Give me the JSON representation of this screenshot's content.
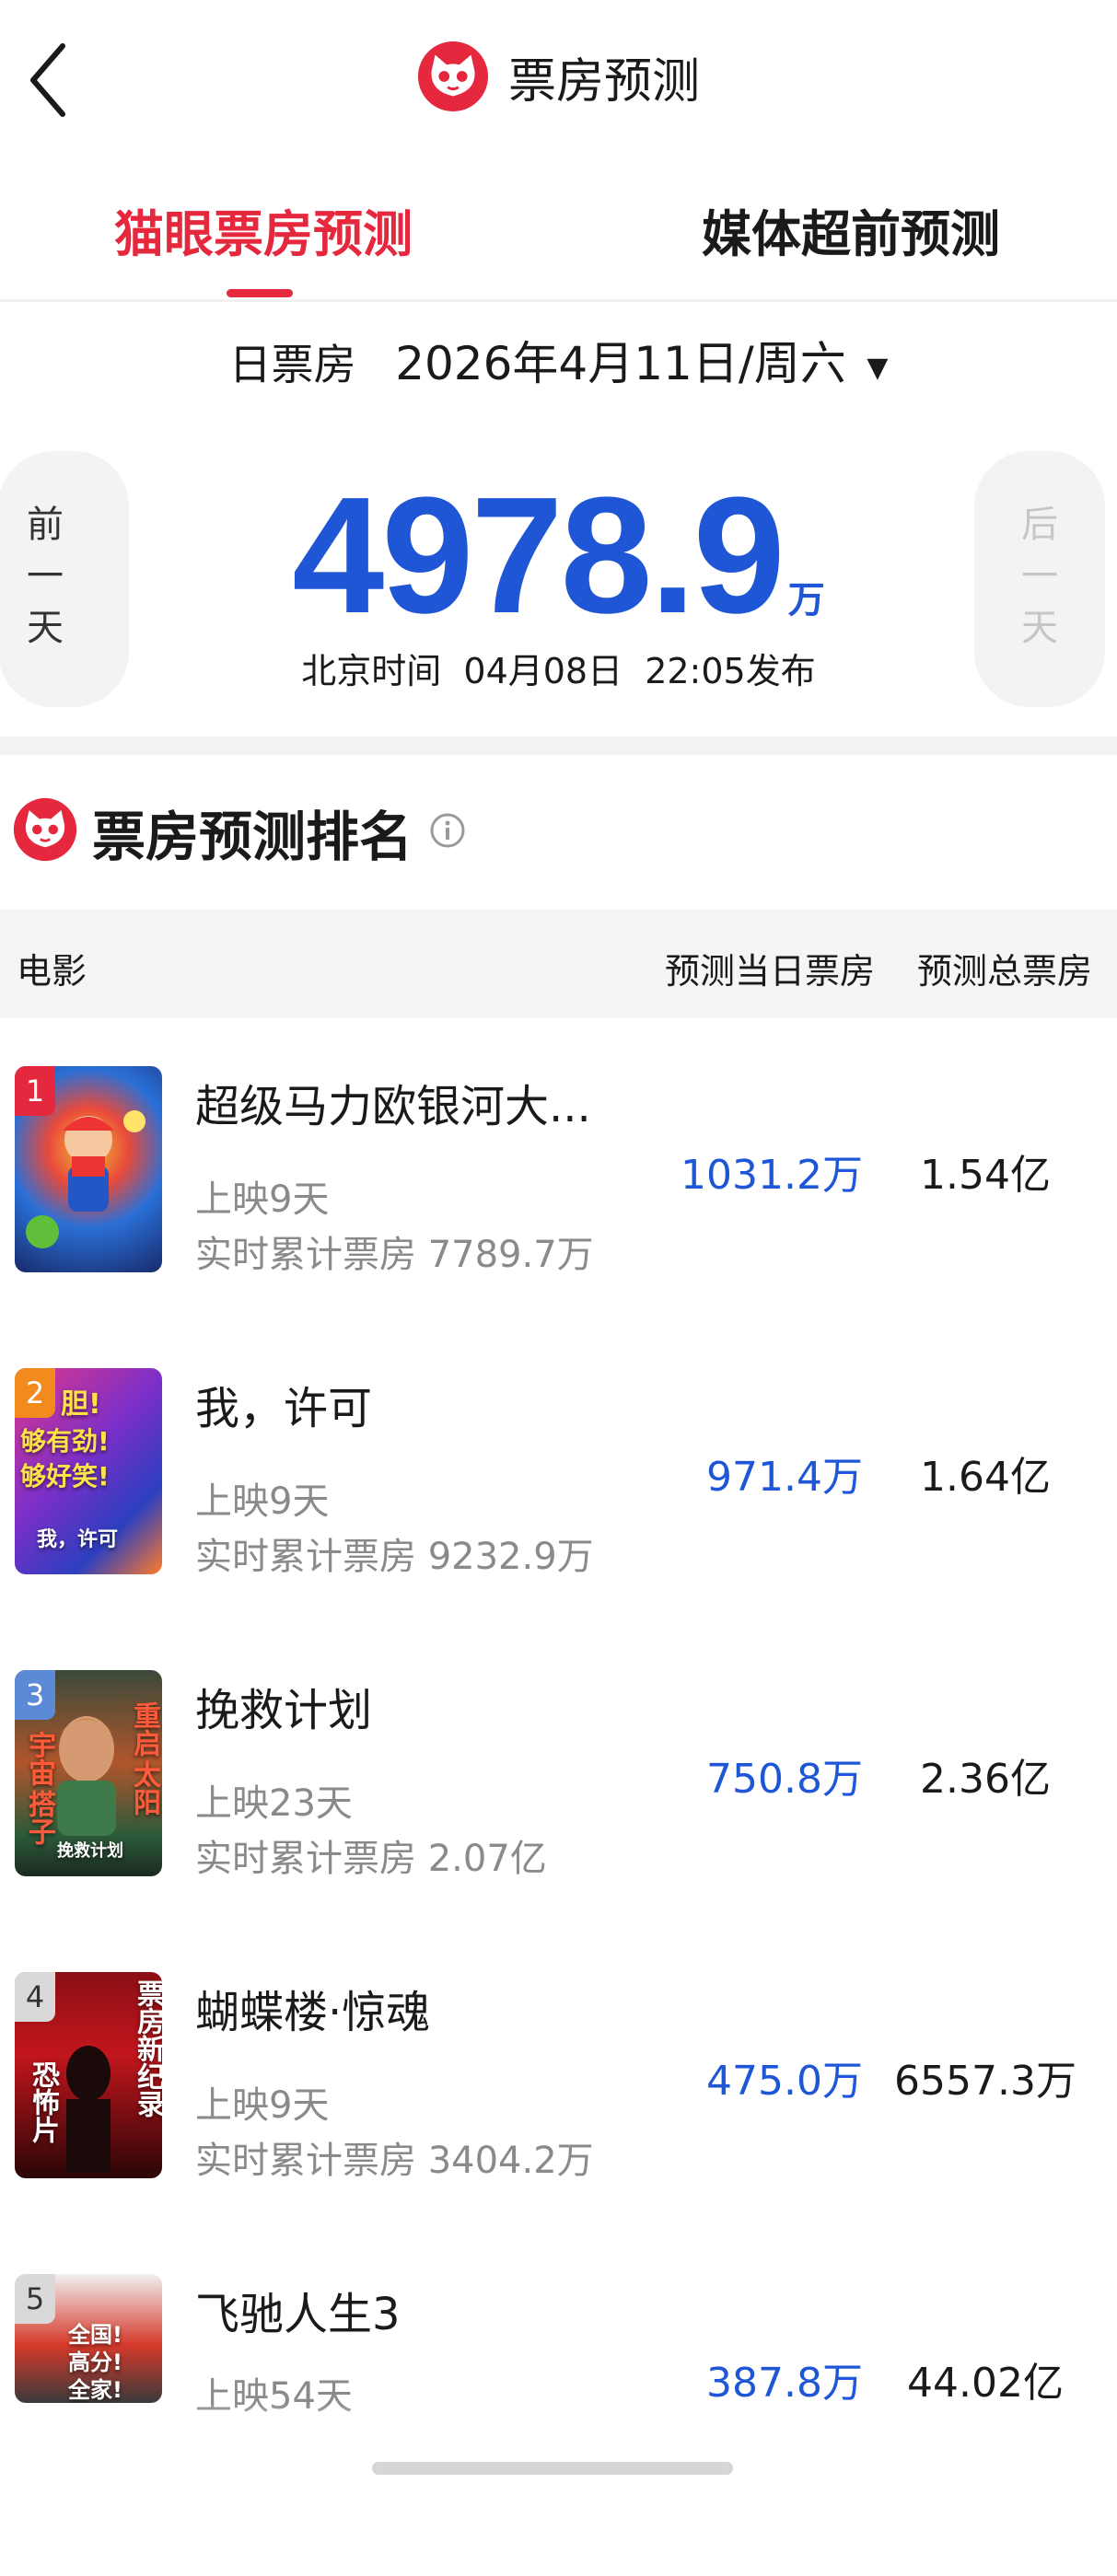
{
  "header": {
    "title": "票房预测"
  },
  "tabs": [
    {
      "label": "猫眼票房预测",
      "active": true
    },
    {
      "label": "媒体超前预测",
      "active": false
    }
  ],
  "date": {
    "label": "日票房",
    "value": "2026年4月11日/周六",
    "arrow": "▼"
  },
  "nav": {
    "prev": [
      "前",
      "一",
      "天"
    ],
    "next": [
      "后",
      "一",
      "天"
    ]
  },
  "forecast": {
    "value": "4978.9",
    "unit": "万",
    "release": {
      "zone": "北京时间",
      "date": "04月08日",
      "time": "22:05发布"
    }
  },
  "ranking": {
    "title": "票房预测排名",
    "columns": {
      "movie": "电影",
      "daily": "预测当日票房",
      "total": "预测总票房"
    },
    "rows": [
      {
        "rank": "1",
        "name": "超级马力欧银河大...",
        "days": "上映9天",
        "cumulative": "实时累计票房 7789.7万",
        "daily": "1031.2万",
        "total": "1.54亿"
      },
      {
        "rank": "2",
        "name": "我，许可",
        "days": "上映9天",
        "cumulative": "实时累计票房 9232.9万",
        "daily": "971.4万",
        "total": "1.64亿"
      },
      {
        "rank": "3",
        "name": "挽救计划",
        "days": "上映23天",
        "cumulative": "实时累计票房 2.07亿",
        "daily": "750.8万",
        "total": "2.36亿"
      },
      {
        "rank": "4",
        "name": "蝴蝶楼·惊魂",
        "days": "上映9天",
        "cumulative": "实时累计票房 3404.2万",
        "daily": "475.0万",
        "total": "6557.3万"
      },
      {
        "rank": "5",
        "name": "飞驰人生3",
        "days": "上映54天",
        "cumulative": "",
        "daily": "387.8万",
        "total": "44.02亿"
      }
    ]
  },
  "posters": {
    "2": [
      "胆!",
      "够有劲!",
      "够好笑!",
      "我，许可"
    ],
    "3": [
      "重启",
      "太阳",
      "宇宙",
      "搭子",
      "挽救计划"
    ],
    "4": [
      "票房新纪录",
      "恐怖片"
    ],
    "5": [
      "全国!",
      "高分!",
      "全家!"
    ]
  },
  "colors": {
    "accent": "#e5283d",
    "blue": "#1f56d6",
    "muted": "#8a8a8a"
  }
}
